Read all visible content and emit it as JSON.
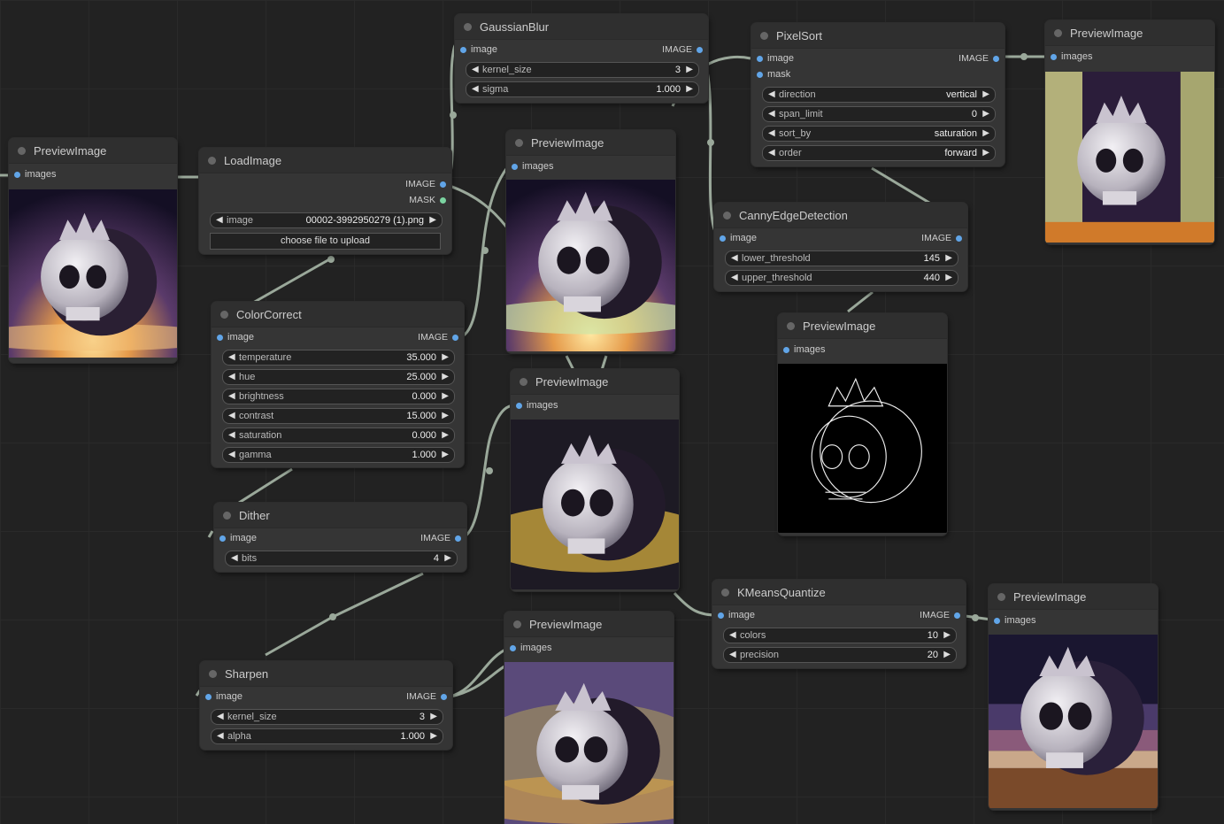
{
  "nodes": {
    "preview_left": {
      "title": "PreviewImage",
      "input": "images"
    },
    "load_image": {
      "title": "LoadImage",
      "outputs": [
        "IMAGE",
        "MASK"
      ],
      "image_label": "image",
      "image_value": "00002-3992950279 (1).png",
      "upload_label": "choose file to upload"
    },
    "gaussian_blur": {
      "title": "GaussianBlur",
      "input": "image",
      "output": "IMAGE",
      "kernel_size_label": "kernel_size",
      "kernel_size_value": "3",
      "sigma_label": "sigma",
      "sigma_value": "1.000"
    },
    "preview_blur": {
      "title": "PreviewImage",
      "input": "images"
    },
    "pixel_sort": {
      "title": "PixelSort",
      "input_image": "image",
      "input_mask": "mask",
      "output": "IMAGE",
      "direction_label": "direction",
      "direction_value": "vertical",
      "span_limit_label": "span_limit",
      "span_limit_value": "0",
      "sort_by_label": "sort_by",
      "sort_by_value": "saturation",
      "order_label": "order",
      "order_value": "forward"
    },
    "preview_pixelsort": {
      "title": "PreviewImage",
      "input": "images"
    },
    "canny": {
      "title": "CannyEdgeDetection",
      "input": "image",
      "output": "IMAGE",
      "lower_label": "lower_threshold",
      "lower_value": "145",
      "upper_label": "upper_threshold",
      "upper_value": "440"
    },
    "preview_canny": {
      "title": "PreviewImage",
      "input": "images"
    },
    "color_correct": {
      "title": "ColorCorrect",
      "input": "image",
      "output": "IMAGE",
      "params": [
        {
          "label": "temperature",
          "value": "35.000"
        },
        {
          "label": "hue",
          "value": "25.000"
        },
        {
          "label": "brightness",
          "value": "0.000"
        },
        {
          "label": "contrast",
          "value": "15.000"
        },
        {
          "label": "saturation",
          "value": "0.000"
        },
        {
          "label": "gamma",
          "value": "1.000"
        }
      ]
    },
    "preview_color": {
      "title": "PreviewImage",
      "input": "images"
    },
    "dither": {
      "title": "Dither",
      "input": "image",
      "output": "IMAGE",
      "bits_label": "bits",
      "bits_value": "4"
    },
    "kmeans": {
      "title": "KMeansQuantize",
      "input": "image",
      "output": "IMAGE",
      "colors_label": "colors",
      "colors_value": "10",
      "precision_label": "precision",
      "precision_value": "20"
    },
    "preview_kmeans": {
      "title": "PreviewImage",
      "input": "images"
    },
    "sharpen": {
      "title": "Sharpen",
      "input": "image",
      "output": "IMAGE",
      "kernel_label": "kernel_size",
      "kernel_value": "3",
      "alpha_label": "alpha",
      "alpha_value": "1.000"
    },
    "preview_sharpen": {
      "title": "PreviewImage",
      "input": "images"
    }
  },
  "colors": {
    "wire": "#9aa89a",
    "image_port": "#61a5e8",
    "mask_port": "#7bd4a1"
  },
  "icons": {
    "arrow_left": "◀",
    "arrow_right": "▶"
  }
}
